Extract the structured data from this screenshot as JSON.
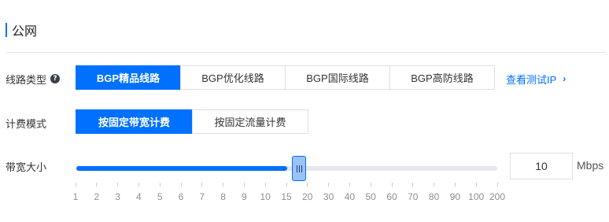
{
  "section": {
    "title": "公网"
  },
  "line_type": {
    "label": "线路类型",
    "help_icon": "question-circle-icon",
    "options": [
      "BGP精品线路",
      "BGP优化线路",
      "BGP国际线路",
      "BGP高防线路"
    ],
    "selected": "BGP精品线路",
    "test_ip_link": "查看测试IP",
    "link_icon": "chevron-right-icon"
  },
  "billing": {
    "label": "计费模式",
    "options": [
      "按固定带宽计费",
      "按固定流量计费"
    ],
    "selected": "按固定带宽计费"
  },
  "bandwidth": {
    "label": "带宽大小",
    "value": "10",
    "unit": "Mbps",
    "slider_level": 0.5,
    "ticks": [
      "1",
      "2",
      "3",
      "4",
      "5",
      "6",
      "7",
      "8",
      "9",
      "10",
      "15",
      "20",
      "30",
      "40",
      "50",
      "60",
      "70",
      "80",
      "90",
      "100",
      "200"
    ]
  },
  "colors": {
    "accent": "#0070ff",
    "track": "#e6e8ed",
    "thumb": "#9cc3f6"
  }
}
